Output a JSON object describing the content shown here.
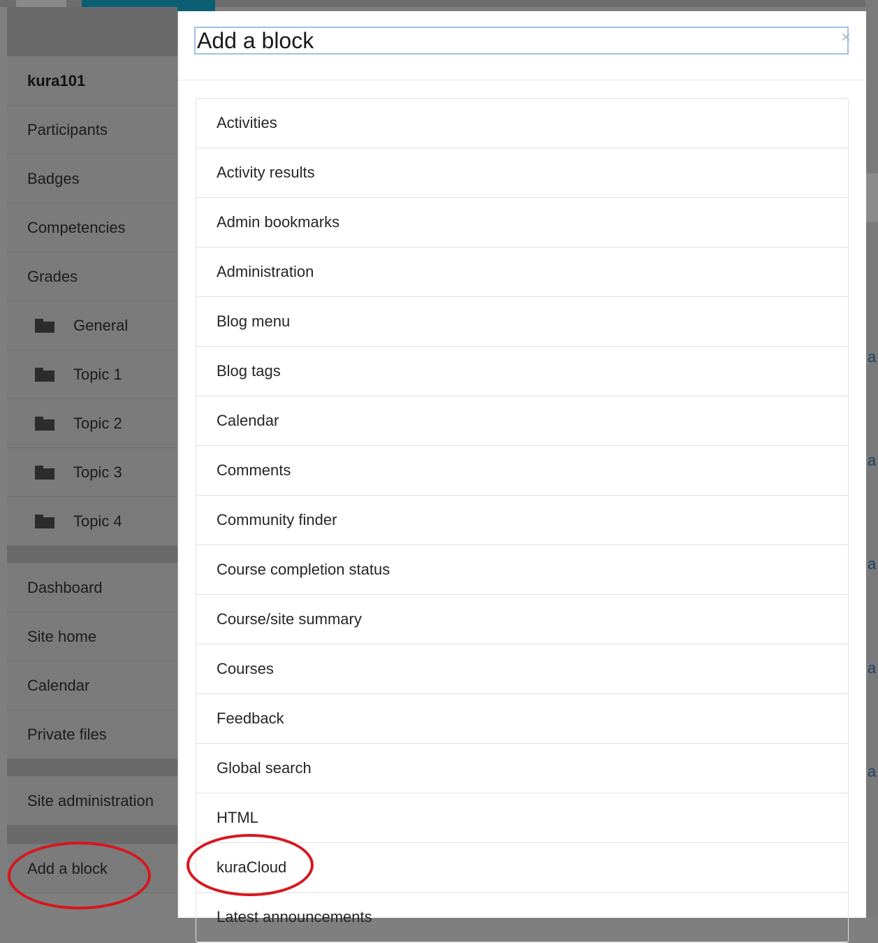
{
  "sidebar": {
    "course_name": "kura101",
    "course_items": [
      {
        "label": "Participants"
      },
      {
        "label": "Badges"
      },
      {
        "label": "Competencies"
      },
      {
        "label": "Grades"
      }
    ],
    "sections": [
      {
        "label": "General",
        "icon": "folder-icon"
      },
      {
        "label": "Topic 1",
        "icon": "folder-icon"
      },
      {
        "label": "Topic 2",
        "icon": "folder-icon"
      },
      {
        "label": "Topic 3",
        "icon": "folder-icon"
      },
      {
        "label": "Topic 4",
        "icon": "folder-icon"
      }
    ],
    "site_items": [
      {
        "label": "Dashboard"
      },
      {
        "label": "Site home"
      },
      {
        "label": "Calendar"
      },
      {
        "label": "Private files"
      }
    ],
    "admin_item": "Site administration",
    "add_block": "Add a block"
  },
  "background": {
    "right_edge_letter": "a"
  },
  "modal": {
    "title": "Add a block",
    "close_label": "×",
    "blocks": [
      "Activities",
      "Activity results",
      "Admin bookmarks",
      "Administration",
      "Blog menu",
      "Blog tags",
      "Calendar",
      "Comments",
      "Community finder",
      "Course completion status",
      "Course/site summary",
      "Courses",
      "Feedback",
      "Global search",
      "HTML",
      "kuraCloud",
      "Latest announcements"
    ]
  },
  "annotations": {
    "highlight_color": "#d8161d",
    "highlighted_items": [
      "Add a block",
      "kuraCloud"
    ]
  }
}
